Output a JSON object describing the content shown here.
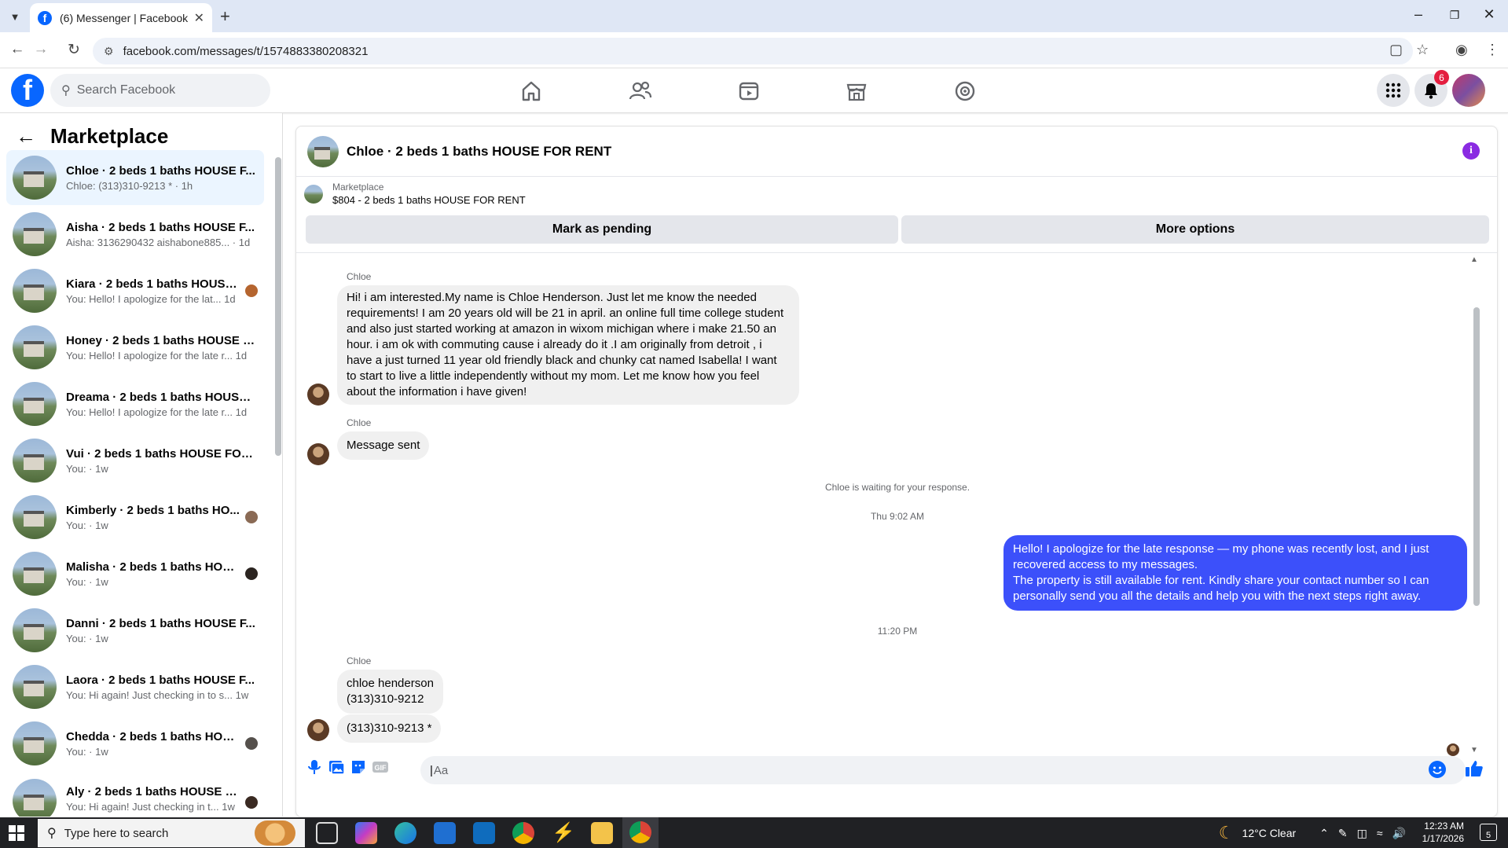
{
  "browser": {
    "tab_title": "(6) Messenger | Facebook",
    "url": "facebook.com/messages/t/1574883380208321"
  },
  "header": {
    "search_placeholder": "Search Facebook",
    "notification_count": "6"
  },
  "sidebar": {
    "title": "Marketplace",
    "items": [
      {
        "title": "Chloe · 2 beds 1 baths HOUSE F...",
        "preview": "Chloe: (313)310-9213 * · 1h",
        "active": true
      },
      {
        "title": "Aisha · 2 beds 1 baths HOUSE F...",
        "preview": "Aisha: 3136290432 aishabone885... · 1d"
      },
      {
        "title": "Kiara · 2 beds 1 baths HOUSE ...",
        "preview": "You: Hello! I apologize for the lat... 1d"
      },
      {
        "title": "Honey · 2 beds 1 baths HOUSE F...",
        "preview": "You: Hello! I apologize for the late r... 1d"
      },
      {
        "title": "Dreama · 2 beds 1 baths HOUSE ...",
        "preview": "You: Hello! I apologize for the late r... 1d"
      },
      {
        "title": "Vui · 2 beds 1 baths HOUSE FOR ...",
        "preview": "You: · 1w"
      },
      {
        "title": "Kimberly · 2 beds 1 baths HO...",
        "preview": "You: · 1w"
      },
      {
        "title": "Malisha · 2 beds 1 baths HOU...",
        "preview": "You: · 1w"
      },
      {
        "title": "Danni · 2 beds 1 baths HOUSE F...",
        "preview": "You: · 1w"
      },
      {
        "title": "Laora · 2 beds 1 baths HOUSE F...",
        "preview": "You: Hi again! Just checking in to s... 1w"
      },
      {
        "title": "Chedda · 2 beds 1 baths HOU...",
        "preview": "You: · 1w"
      },
      {
        "title": "Aly · 2 beds 1 baths HOUSE F...",
        "preview": "You: Hi again! Just checking in t... 1w"
      }
    ]
  },
  "chat": {
    "title": "Chloe · 2 beds 1 baths HOUSE FOR RENT",
    "marketplace_label": "Marketplace",
    "listing": "$804 - 2 beds 1 baths HOUSE FOR RENT",
    "mark_pending": "Mark as pending",
    "more_options": "More options",
    "sender_name": "Chloe",
    "msg1": "Hi! i am interested.My name is Chloe Henderson. Just let me know the needed requirements! I am 20 years old will be 21 in april. an online full time college student and also just started working at amazon in wixom michigan where i make 21.50 an hour. i am ok with commuting cause i already do it .I am originally from detroit , i have a just turned 11 year old friendly black and chunky cat named Isabella! I want to start to live a little independently without my mom. Let me know how you feel about the information i have given!",
    "msg2": "Message sent",
    "waiting": "Chloe is waiting for your response.",
    "time1": "Thu 9:02 AM",
    "reply": "Hello! I apologize for the late response — my phone was recently lost, and I just recovered access to my messages.\nThe property is still available for rent. Kindly share your contact number so I can personally send you all the details and help you with the next steps right away.",
    "time2": "11:20 PM",
    "msg3a": "chloe henderson",
    "msg3b": "(313)310-9212",
    "msg4": "(313)310-9213 *",
    "input_placeholder": "Aa"
  },
  "taskbar": {
    "search_placeholder": "Type here to search",
    "weather": "12°C  Clear",
    "time": "12:23 AM",
    "date": "1/17/2026",
    "notif_count": "5"
  },
  "colors": {
    "accent": "#0866ff",
    "outgoing_bubble": "#3c50fa",
    "active_row": "#ebf5ff"
  }
}
